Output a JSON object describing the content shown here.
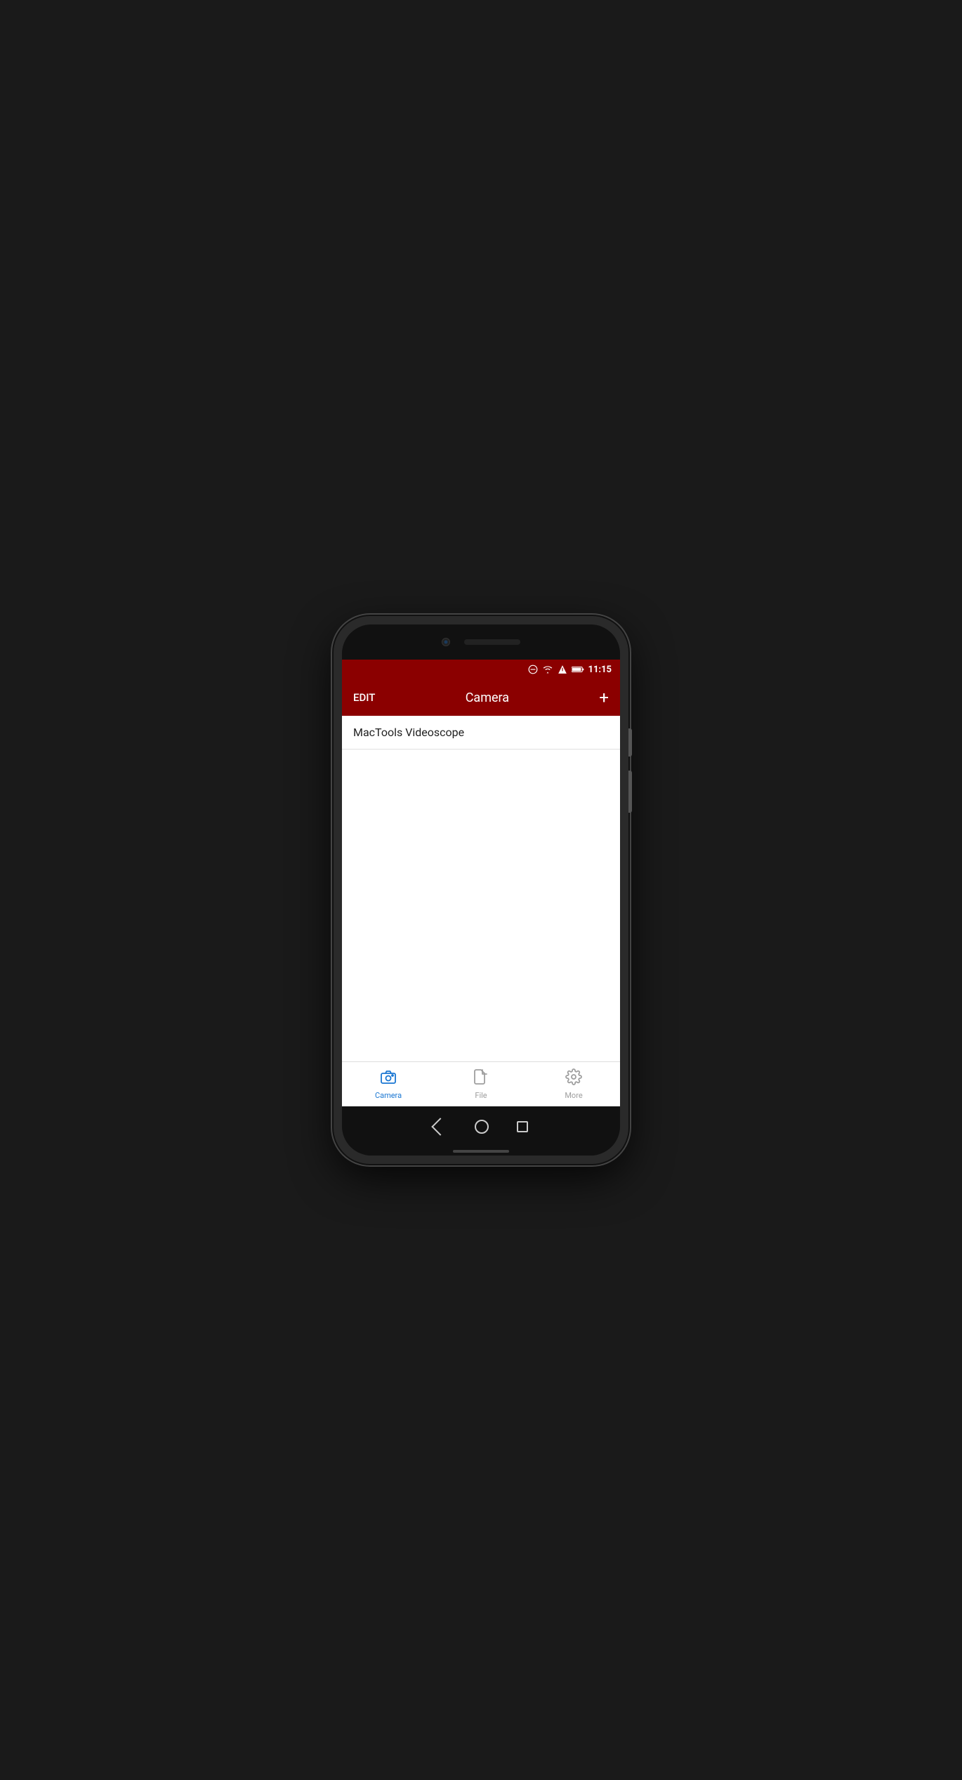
{
  "statusBar": {
    "time": "11:15",
    "icons": [
      "minus-circle",
      "wifi",
      "signal",
      "battery"
    ]
  },
  "toolbar": {
    "editLabel": "EDIT",
    "title": "Camera",
    "addLabel": "+"
  },
  "content": {
    "listItems": [
      {
        "label": "MacTools Videoscope"
      }
    ]
  },
  "bottomNav": {
    "items": [
      {
        "id": "camera",
        "label": "Camera",
        "active": true
      },
      {
        "id": "file",
        "label": "File",
        "active": false
      },
      {
        "id": "more",
        "label": "More",
        "active": false
      }
    ]
  },
  "systemNav": {
    "back": "back-icon",
    "home": "home-icon",
    "recent": "recent-icon"
  }
}
